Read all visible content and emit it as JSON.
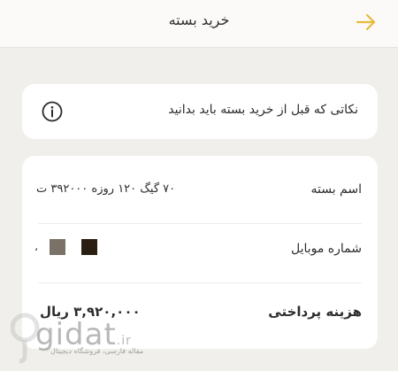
{
  "header": {
    "title": "خرید بسته"
  },
  "info": {
    "text": "نکاتی که قبل از خرید بسته باید بدانید"
  },
  "details": {
    "package_label": "اسم بسته",
    "package_value": "۷۰ گیگ ۱۲۰ روزه ۳۹۲۰۰۰ ت",
    "mobile_label": "شماره موبایل",
    "mobile_suffix": "،",
    "payment_label": "هزینه پرداختی",
    "payment_value": "۳,۹۲۰,۰۰۰ ریال"
  },
  "watermark": {
    "logo_text": "gidat",
    "domain": ".ir",
    "subtitle": "مقاله فارسی، فروشگاه دیجیتال"
  },
  "colors": {
    "background": "#f1efec",
    "card": "#ffffff",
    "accent": "#e8b93a",
    "mask_gray": "#7a7267",
    "mask_dark": "#2a1f12"
  }
}
